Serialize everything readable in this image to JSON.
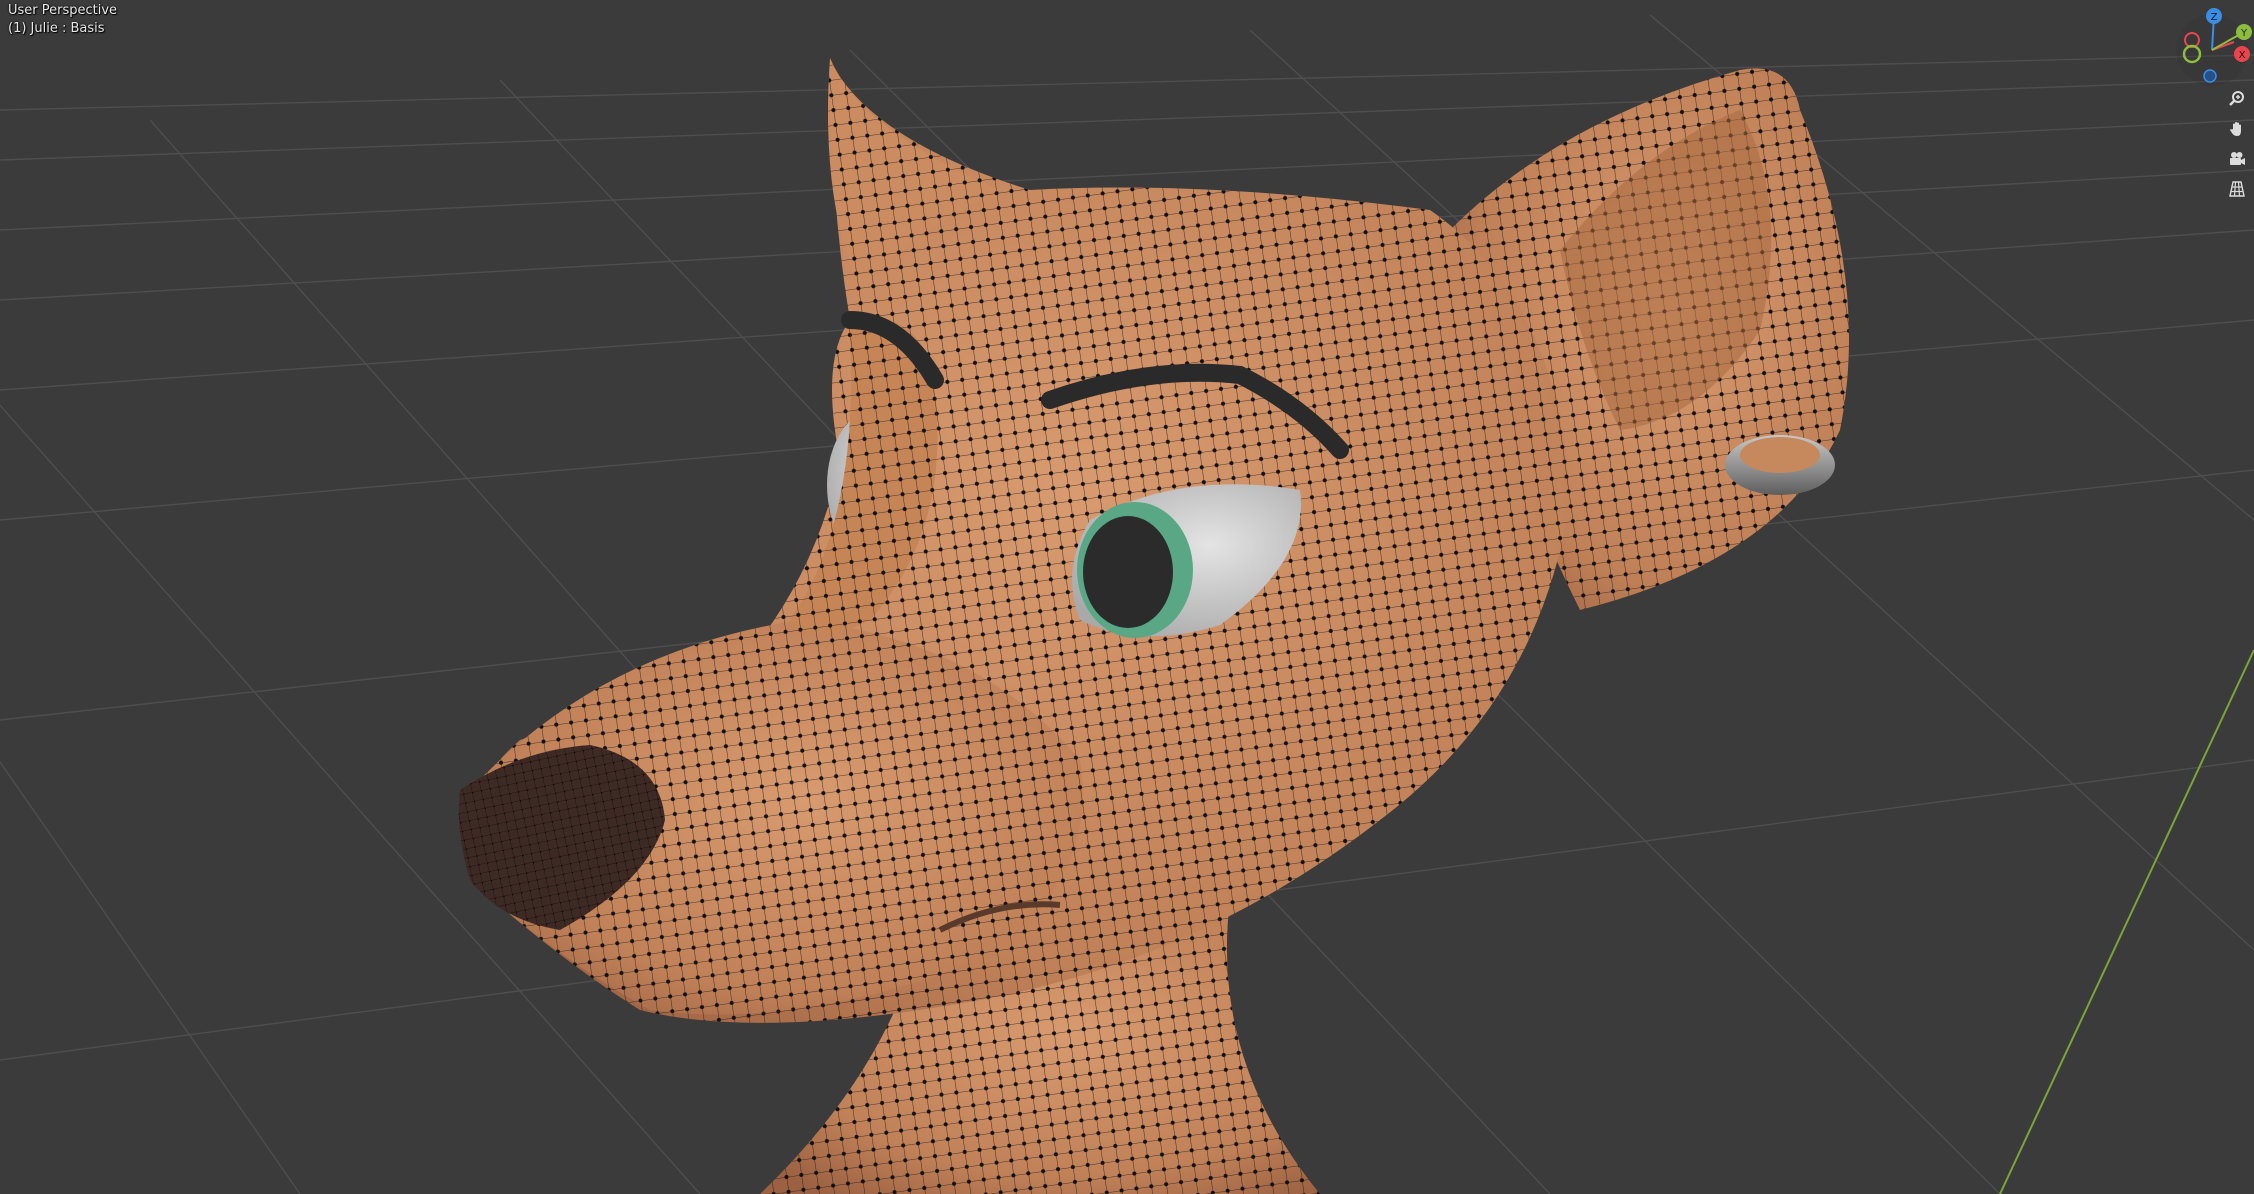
{
  "viewport": {
    "view_name": "User Perspective",
    "object_info": "(1) Julie : Basis"
  },
  "gizmo": {
    "axis_z_label": "Z",
    "axis_y_label": "Y",
    "axis_x_label": "X",
    "colors": {
      "x": "#e8454f",
      "y": "#8cbd3f",
      "z": "#3b8ee6"
    }
  },
  "navigation": {
    "zoom_icon": "magnifier-icon",
    "pan_icon": "hand-icon",
    "camera_icon": "camera-icon",
    "ortho_icon": "grid-icon"
  },
  "scene": {
    "background": "#3b3b3b",
    "grid_color": "#505050",
    "y_axis_line_color": "#7ba43a",
    "skin_color": "#c98b62",
    "wire_color": "#1c120c",
    "nose_color": "#3e2a25",
    "eye_white": "#d4d4d4",
    "iris_color": "#5aa785",
    "pupil_color": "#2b2b2b",
    "earring_color": "#9c9c9c"
  }
}
